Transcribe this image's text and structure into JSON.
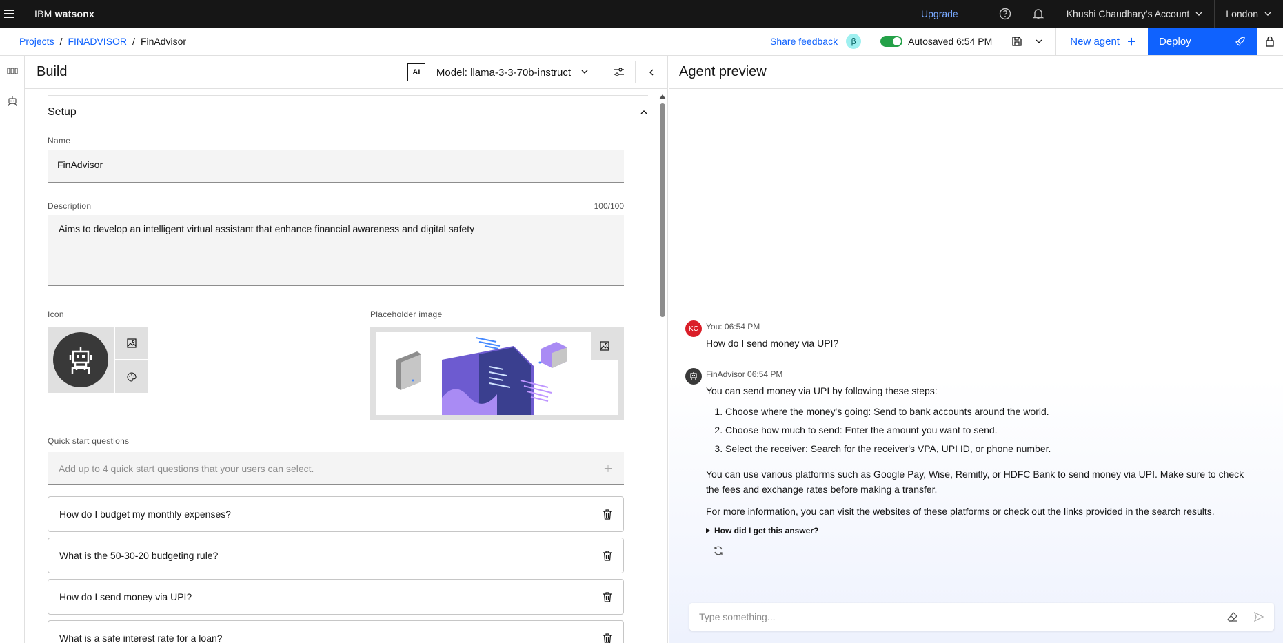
{
  "topbar": {
    "brand_prefix": "IBM",
    "brand_product": "watsonx",
    "upgrade": "Upgrade",
    "account": "Khushi Chaudhary's Account",
    "region": "London"
  },
  "subbar": {
    "breadcrumbs": [
      "Projects",
      "FINADVISOR",
      "FinAdvisor"
    ],
    "share_feedback": "Share feedback",
    "beta": "β",
    "autosaved": "Autosaved 6:54 PM",
    "new_agent": "New agent",
    "deploy": "Deploy"
  },
  "build": {
    "title": "Build",
    "ai_badge": "AI",
    "model": "Model: llama-3-3-70b-instruct",
    "setup_title": "Setup",
    "name_label": "Name",
    "name_value": "FinAdvisor",
    "description_label": "Description",
    "description_count": "100/100",
    "description_value": "Aims to develop an intelligent virtual assistant that enhance financial awareness and digital safety",
    "icon_label": "Icon",
    "placeholder_label": "Placeholder image",
    "quick_start_label": "Quick start questions",
    "quick_start_placeholder": "Add up to 4 quick start questions that your users can select.",
    "questions": [
      "How do I budget my monthly expenses?",
      "What is the 50-30-20 budgeting rule?",
      "How do I send money via UPI?",
      "What is a safe interest rate for a loan?"
    ]
  },
  "preview": {
    "title": "Agent preview",
    "user_initials": "KC",
    "user_meta": "You: 06:54 PM",
    "user_message": "How do I send money via UPI?",
    "agent_meta": "FinAdvisor 06:54 PM",
    "agent_intro": "You can send money via UPI by following these steps:",
    "agent_steps": [
      "Choose where the money's going: Send to bank accounts around the world.",
      "Choose how much to send: Enter the amount you want to send.",
      "Select the receiver: Search for the receiver's VPA, UPI ID, or phone number."
    ],
    "agent_para1": "You can use various platforms such as Google Pay, Wise, Remitly, or HDFC Bank to send money via UPI. Make sure to check the fees and exchange rates before making a transfer.",
    "agent_para2": "For more information, you can visit the websites of these platforms or check out the links provided in the search results.",
    "how_answer": "How did I get this answer?",
    "input_placeholder": "Type something..."
  },
  "colors": {
    "accent": "#0f62fe",
    "topbar_bg": "#161616",
    "user_avatar": "#da1e28",
    "agent_avatar": "#393939",
    "toggle_on": "#24a148"
  }
}
